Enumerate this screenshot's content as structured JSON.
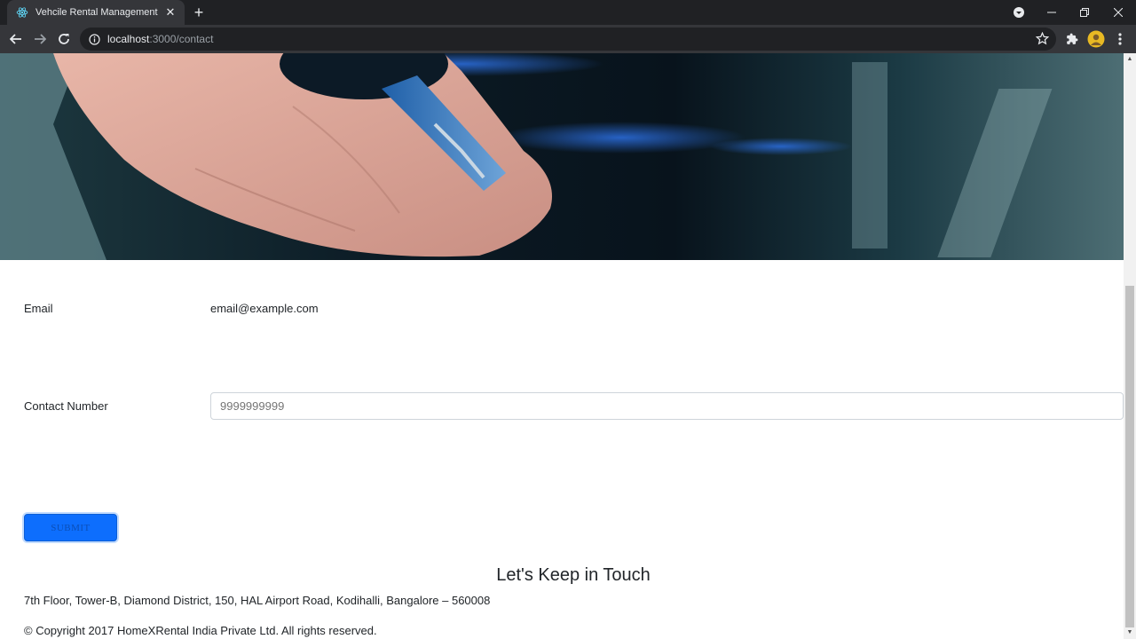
{
  "browser": {
    "tab_title": "Vehcile Rental Management System",
    "url_host": "localhost",
    "url_path": ":3000/contact"
  },
  "icons": {
    "favicon": "react-icon",
    "back": "arrow-left-icon",
    "forward": "arrow-right-icon",
    "reload": "reload-icon",
    "site_info": "info-icon",
    "bookmark": "star-icon",
    "extensions": "puzzle-icon",
    "menu": "kebab-menu-icon"
  },
  "form": {
    "email_label": "Email",
    "email_value": "email@example.com",
    "contact_label": "Contact Number",
    "contact_placeholder": "9999999999",
    "submit_label": "SUBMIT"
  },
  "footer": {
    "title": "Let's Keep in Touch",
    "address": "7th Floor, Tower-B, Diamond District, 150, HAL Airport Road, Kodihalli, Bangalore – 560008",
    "copyright": "© Copyright 2017 HomeXRental India Private Ltd. All rights reserved."
  },
  "colors": {
    "primary": "#0d6efd",
    "chrome_dark": "#202124",
    "chrome_toolbar": "#35363a"
  }
}
